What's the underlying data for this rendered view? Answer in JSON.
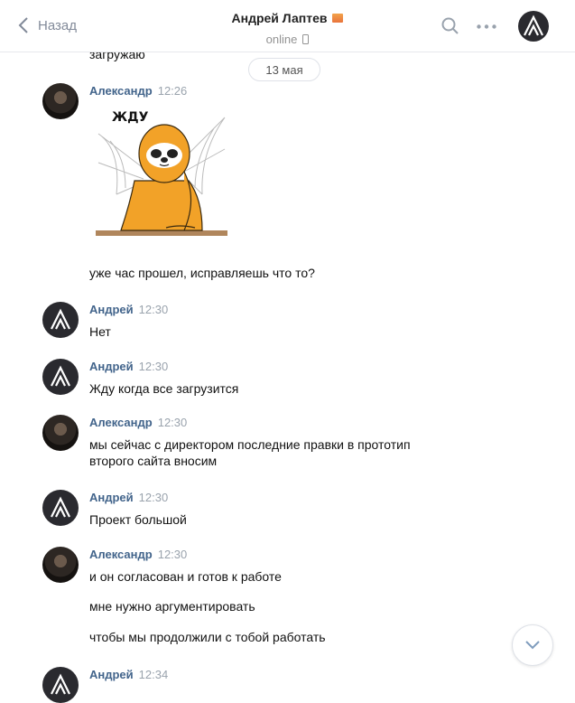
{
  "header": {
    "back_label": "Назад",
    "title": "Андрей Лаптев",
    "status": "online"
  },
  "date_divider": "13 мая",
  "partial_text": "загружаю",
  "sticker_text": "ЖДУ",
  "messages": [
    {
      "name": "Александр",
      "time": "12:26",
      "extra": "уже час прошел, исправляешь что то?"
    },
    {
      "name": "Андрей",
      "time": "12:30",
      "text": "Нет"
    },
    {
      "name": "Андрей",
      "time": "12:30",
      "text": "Жду когда все загрузится"
    },
    {
      "name": "Александр",
      "time": "12:30",
      "text": "мы сейчас с директором последние правки в прототип второго сайта вносим"
    },
    {
      "name": "Андрей",
      "time": "12:30",
      "text": "Проект большой"
    },
    {
      "name": "Александр",
      "time": "12:30",
      "text": "и он согласован и готов к работе",
      "extra1": "мне нужно аргументировать",
      "extra2": "чтобы мы продолжили с тобой работать"
    },
    {
      "name": "Андрей",
      "time": "12:34"
    }
  ]
}
